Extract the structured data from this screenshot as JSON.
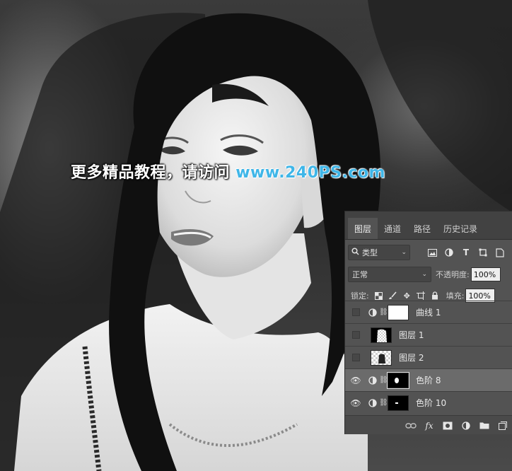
{
  "watermark": {
    "cn_text": "更多精品教程，请访问",
    "url_text": "www.240PS.com"
  },
  "panel": {
    "tabs": [
      {
        "label": "图层",
        "active": true
      },
      {
        "label": "通道",
        "active": false
      },
      {
        "label": "路径",
        "active": false
      },
      {
        "label": "历史记录",
        "active": false
      }
    ],
    "filter": {
      "kind_label": "类型"
    },
    "blend": {
      "mode": "正常",
      "opacity_label": "不透明度:",
      "opacity_value": "100%"
    },
    "lock": {
      "label": "锁定:",
      "fill_label": "填充:",
      "fill_value": "100%"
    },
    "layers": [
      {
        "name": "曲线 1",
        "visible": false,
        "type": "adjustment",
        "thumb": "white",
        "selected": false
      },
      {
        "name": "图层 1",
        "visible": false,
        "type": "pixel",
        "thumb": "black-checker",
        "selected": false
      },
      {
        "name": "图层 2",
        "visible": false,
        "type": "pixel",
        "thumb": "checker",
        "selected": false
      },
      {
        "name": "色阶 8",
        "visible": true,
        "type": "adjustment",
        "thumb": "black-mask-blob",
        "selected": true
      },
      {
        "name": "色阶 10",
        "visible": true,
        "type": "adjustment",
        "thumb": "black-mask-dot",
        "selected": false
      }
    ]
  },
  "colors": {
    "panel_bg": "#535353",
    "tab_bar_bg": "#424242",
    "selected_row": "#6b6b6b",
    "watermark_url": "#3fb6e8"
  }
}
